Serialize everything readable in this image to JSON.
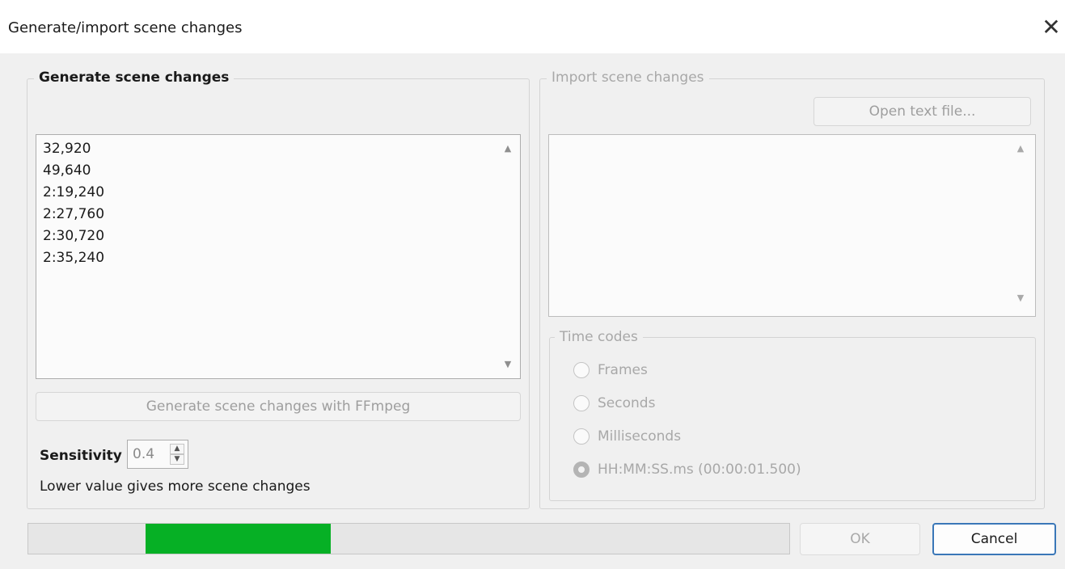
{
  "window": {
    "title": "Generate/import scene changes"
  },
  "generate": {
    "group_title": "Generate scene changes",
    "list_items": [
      "32,920",
      "49,640",
      "2:19,240",
      "2:27,760",
      "2:30,720",
      "2:35,240"
    ],
    "button_label": "Generate scene changes with FFmpeg",
    "sensitivity_label": "Sensitivity",
    "sensitivity_value": "0.4",
    "hint": "Lower value gives more scene changes"
  },
  "import": {
    "group_title": "Import scene changes",
    "open_button": "Open text file...",
    "timecodes": {
      "group_title": "Time codes",
      "options": [
        "Frames",
        "Seconds",
        "Milliseconds",
        "HH:MM:SS.ms (00:00:01.500)"
      ],
      "selected_index": 3
    }
  },
  "footer": {
    "progress": {
      "filled_segment_start": 0.154,
      "filled_segment_end": 0.397
    },
    "ok_label": "OK",
    "cancel_label": "Cancel"
  },
  "icons": {
    "close": "close-icon",
    "scroll_up": "scroll-up-arrow-icon",
    "scroll_down": "scroll-down-arrow-icon",
    "spin_up": "spin-up-icon",
    "spin_down": "spin-down-icon"
  },
  "colors": {
    "progress": "#06b025",
    "focus_border": "#3a77b8"
  }
}
